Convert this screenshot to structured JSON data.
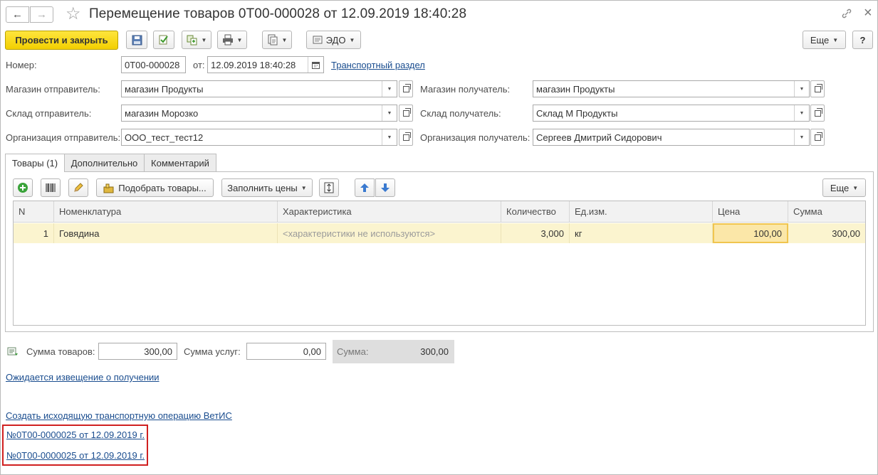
{
  "window": {
    "title": "Перемещение товаров 0Т00-000028 от 12.09.2019 18:40:28",
    "back_icon": "←",
    "forward_icon": "→",
    "star_icon": "☆",
    "link_icon": "🔗",
    "close_icon": "×"
  },
  "toolbar": {
    "post_close_label": "Провести и закрыть",
    "edo_label": "ЭДО",
    "more_label": "Еще",
    "help_label": "?"
  },
  "header": {
    "number_label": "Номер:",
    "number_value": "0Т00-000028",
    "date_label": "от:",
    "date_value": "12.09.2019 18:40:28",
    "transport_link": "Транспортный раздел",
    "sender_store_label": "Магазин отправитель:",
    "sender_store_value": "магазин Продукты",
    "receiver_store_label": "Магазин получатель:",
    "receiver_store_value": "магазин Продукты",
    "sender_warehouse_label": "Склад отправитель:",
    "sender_warehouse_value": "магазин Морозко",
    "receiver_warehouse_label": "Склад получатель:",
    "receiver_warehouse_value": "Склад М Продукты",
    "sender_org_label": "Организация отправитель:",
    "sender_org_value": "ООО_тест_тест12",
    "receiver_org_label": "Организация получатель:",
    "receiver_org_value": "Сергеев Дмитрий Сидорович"
  },
  "tabs": [
    {
      "label": "Товары (1)"
    },
    {
      "label": "Дополнительно"
    },
    {
      "label": "Комментарий"
    }
  ],
  "table_toolbar": {
    "pick_goods_label": "Подобрать товары...",
    "fill_prices_label": "Заполнить цены",
    "more_label": "Еще"
  },
  "table": {
    "columns": [
      "N",
      "Номенклатура",
      "Характеристика",
      "Количество",
      "Ед.изм.",
      "Цена",
      "Сумма"
    ],
    "rows": [
      {
        "n": "1",
        "item": "Говядина",
        "characteristic": "<характеристики не используются>",
        "qty": "3,000",
        "unit": "кг",
        "price": "100,00",
        "sum": "300,00"
      }
    ]
  },
  "totals": {
    "goods_sum_label": "Сумма товаров:",
    "goods_sum_value": "300,00",
    "services_sum_label": "Сумма услуг:",
    "services_sum_value": "0,00",
    "total_label": "Сумма:",
    "total_value": "300,00"
  },
  "links": {
    "awaiting_notice": "Ожидается извещение о получении",
    "create_vetis": "Создать исходящую транспортную операцию ВетИС",
    "doc_link_1": "№0Т00-0000025 от 12.09.2019 г.",
    "doc_link_2": "№0Т00-0000025 от 12.09.2019 г."
  },
  "colors": {
    "primary_button": "#f5d300",
    "selected_row": "#fbf4cf",
    "link": "#1a4d8f",
    "highlight_box": "#d02020"
  }
}
